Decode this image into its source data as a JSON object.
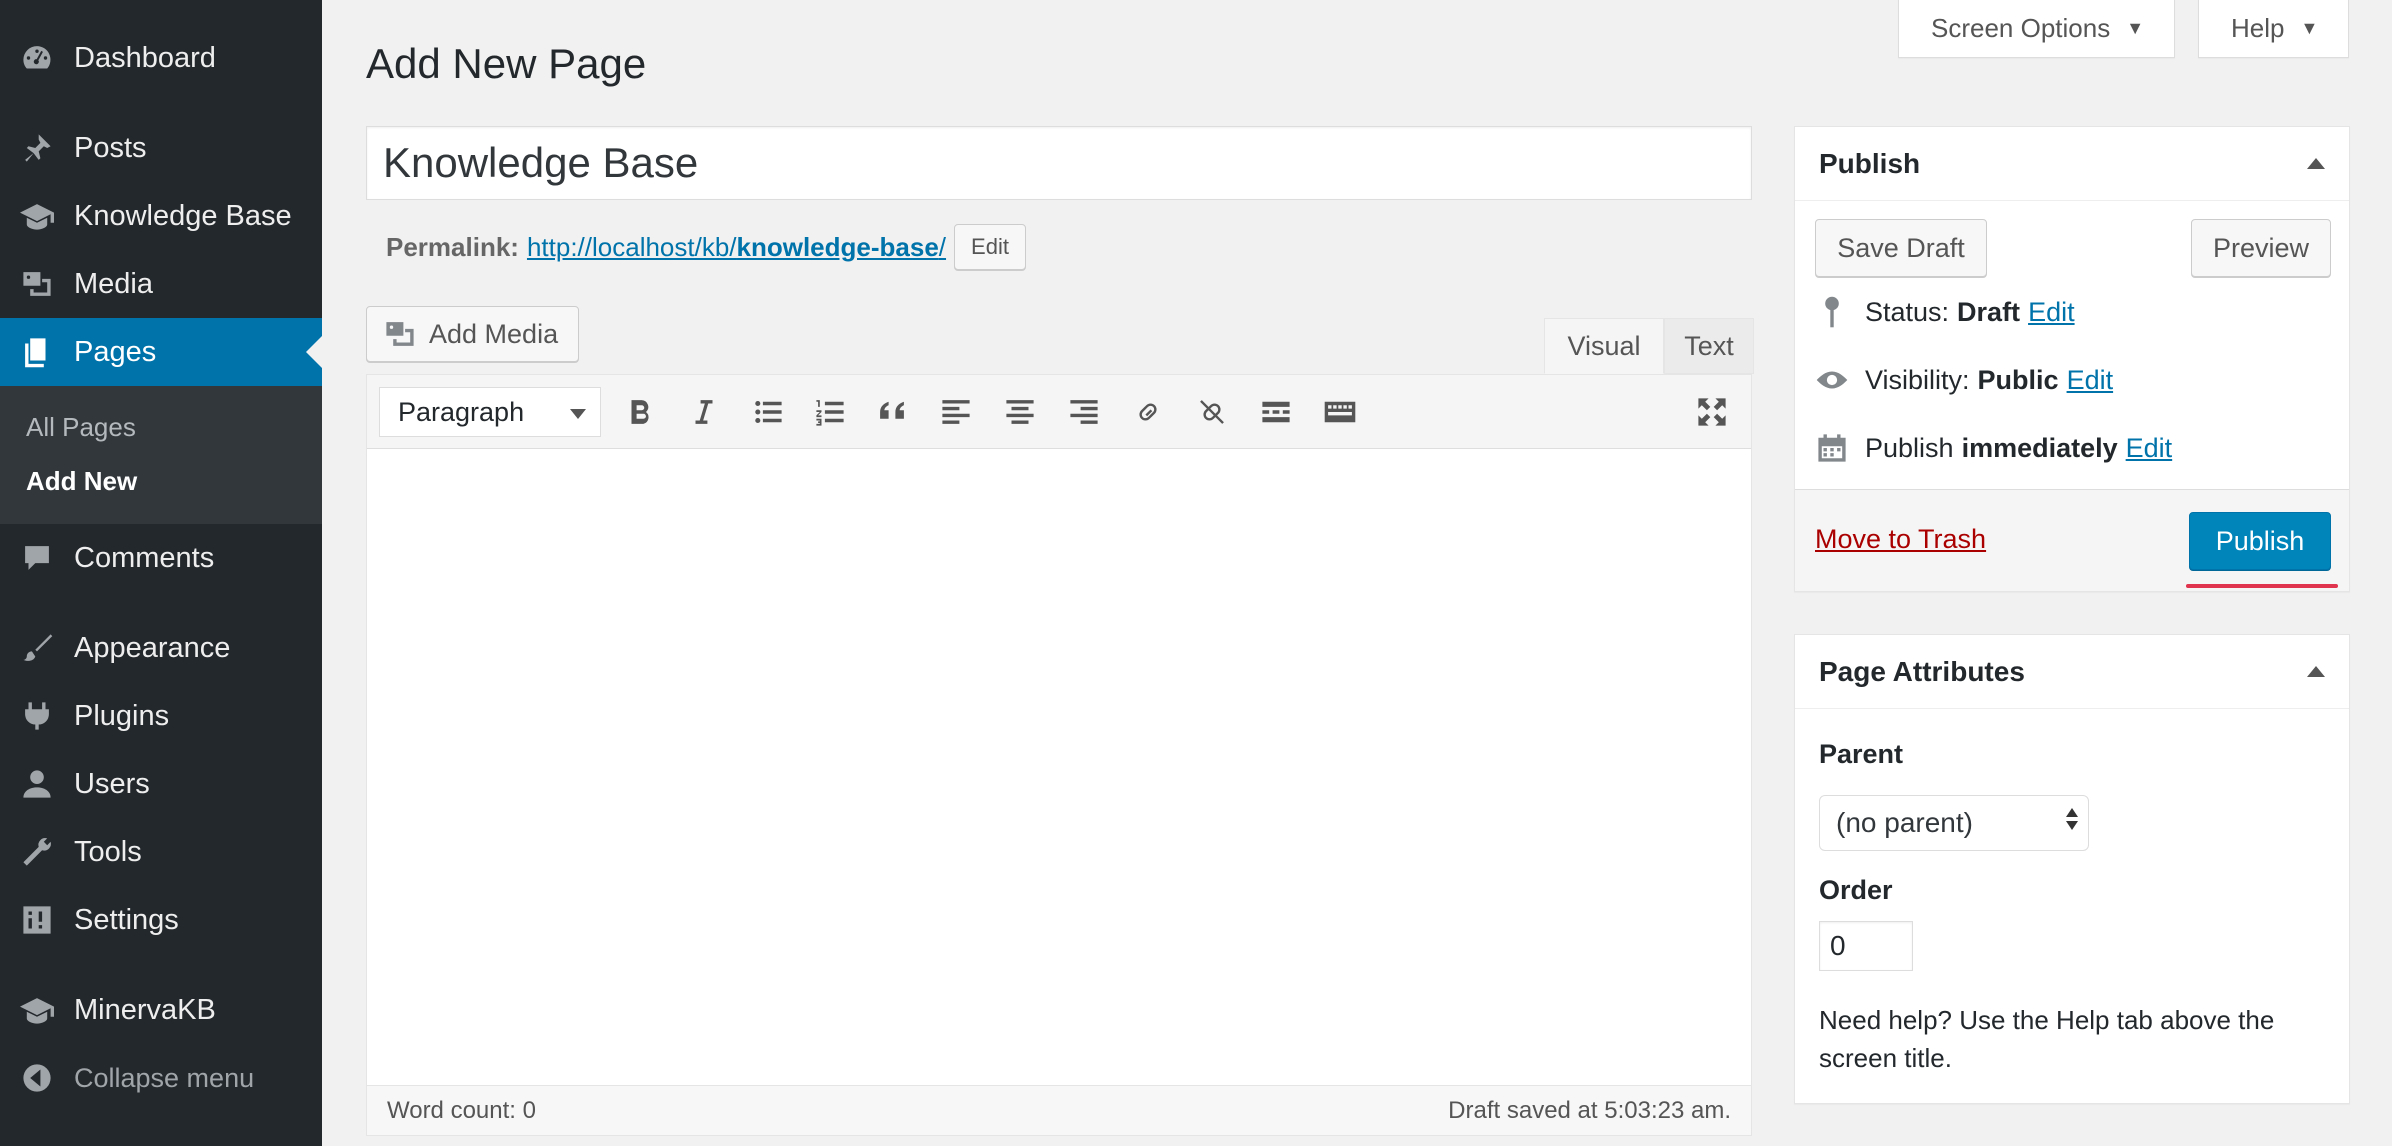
{
  "sidebar": {
    "items": [
      {
        "label": "Dashboard",
        "icon": "dashboard-icon"
      },
      {
        "label": "Posts",
        "icon": "pin-icon"
      },
      {
        "label": "Knowledge Base",
        "icon": "graduation-cap-icon"
      },
      {
        "label": "Media",
        "icon": "media-icon"
      },
      {
        "label": "Pages",
        "icon": "pages-icon"
      },
      {
        "label": "Comments",
        "icon": "comment-icon"
      },
      {
        "label": "Appearance",
        "icon": "brush-icon"
      },
      {
        "label": "Plugins",
        "icon": "plug-icon"
      },
      {
        "label": "Users",
        "icon": "user-icon"
      },
      {
        "label": "Tools",
        "icon": "wrench-icon"
      },
      {
        "label": "Settings",
        "icon": "sliders-icon"
      },
      {
        "label": "MinervaKB",
        "icon": "graduation-cap-icon"
      }
    ],
    "submenu": [
      "All Pages",
      "Add New"
    ],
    "collapse_label": "Collapse menu"
  },
  "header": {
    "screen_options": "Screen Options",
    "help": "Help",
    "title": "Add New Page"
  },
  "editor": {
    "title_value": "Knowledge Base",
    "permalink_label": "Permalink:",
    "permalink_base": "http://localhost/kb/",
    "permalink_slug": "knowledge-base",
    "permalink_trail": "/",
    "permalink_edit": "Edit",
    "add_media": "Add Media",
    "tab_visual": "Visual",
    "tab_text": "Text",
    "format": "Paragraph",
    "word_count": "Word count: 0",
    "draft_saved": "Draft saved at 5:03:23 am."
  },
  "publish": {
    "title": "Publish",
    "save_draft": "Save Draft",
    "preview": "Preview",
    "status_label": "Status:",
    "status_value": "Draft",
    "visibility_label": "Visibility:",
    "visibility_value": "Public",
    "publish_label": "Publish",
    "publish_value": "immediately",
    "edit": "Edit",
    "move_to_trash": "Move to Trash",
    "publish_button": "Publish"
  },
  "attributes": {
    "title": "Page Attributes",
    "parent_label": "Parent",
    "parent_value": "(no parent)",
    "order_label": "Order",
    "order_value": "0",
    "help_text": "Need help? Use the Help tab above the screen title."
  },
  "colors": {
    "sidebar": "#23282d",
    "accent": "#0073aa",
    "publish_button": "#0085ba",
    "trash": "#aa0000",
    "highlight": "#e0334e"
  }
}
